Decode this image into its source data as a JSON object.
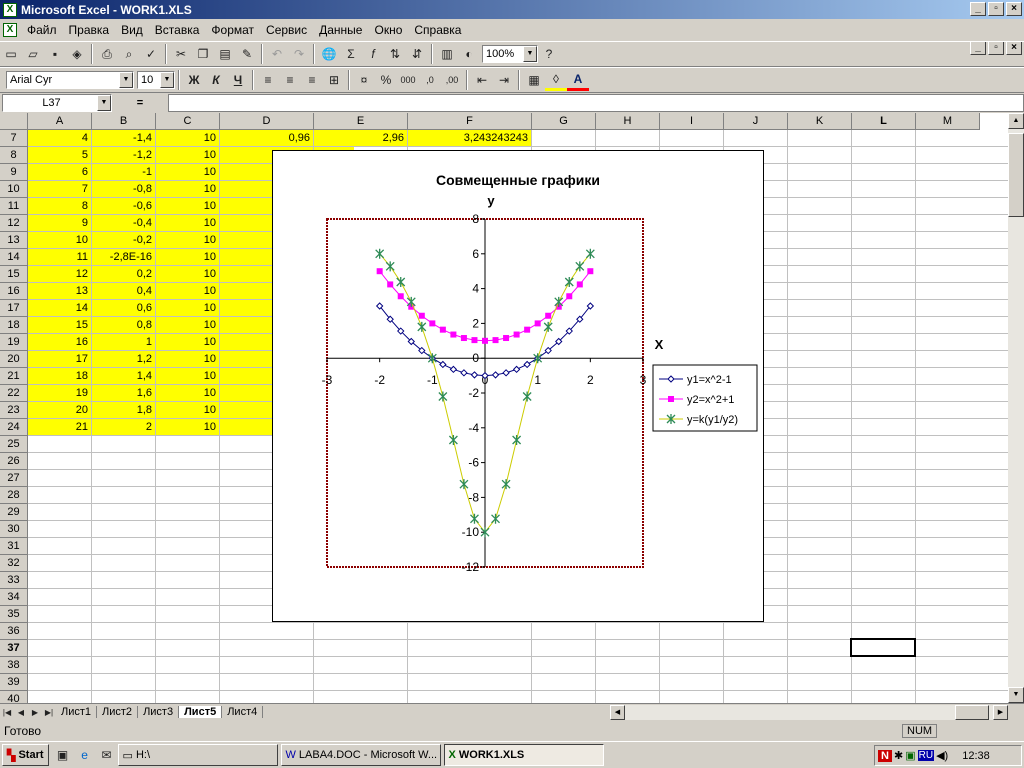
{
  "window": {
    "title": "Microsoft Excel - WORK1.XLS",
    "minimize": "_",
    "restore": "▫",
    "close": "×"
  },
  "menu": [
    "Файл",
    "Правка",
    "Вид",
    "Вставка",
    "Формат",
    "Сервис",
    "Данные",
    "Окно",
    "Справка"
  ],
  "toolbar": {
    "zoom": "100%"
  },
  "format_toolbar": {
    "font": "Arial Cyr",
    "size": "10",
    "bold": "Ж",
    "italic": "К",
    "underline": "Ч"
  },
  "formula_bar": {
    "name_box": "L37",
    "equals": "="
  },
  "columns": [
    "A",
    "B",
    "C",
    "D",
    "E",
    "F",
    "G",
    "H",
    "I",
    "J",
    "K",
    "L",
    "M"
  ],
  "row_numbers": [
    "7",
    "8",
    "9",
    "10",
    "11",
    "12",
    "13",
    "14",
    "15",
    "16",
    "17",
    "18",
    "19",
    "20",
    "21",
    "22",
    "23",
    "24",
    "25",
    "26",
    "27",
    "28",
    "29",
    "30",
    "31",
    "32",
    "33",
    "34",
    "35",
    "36",
    "37",
    "38",
    "39",
    "40"
  ],
  "cells": {
    "A": [
      "4",
      "5",
      "6",
      "7",
      "8",
      "9",
      "10",
      "11",
      "12",
      "13",
      "14",
      "15",
      "16",
      "17",
      "18",
      "19",
      "20",
      "21"
    ],
    "B": [
      "-1,4",
      "-1,2",
      "-1",
      "-0,8",
      "-0,6",
      "-0,4",
      "-0,2",
      "-2,8E-16",
      "0,2",
      "0,4",
      "0,6",
      "0,8",
      "1",
      "1,2",
      "1,4",
      "1,6",
      "1,8",
      "2"
    ],
    "C": [
      "10",
      "10",
      "10",
      "10",
      "10",
      "10",
      "10",
      "10",
      "10",
      "10",
      "10",
      "10",
      "10",
      "10",
      "10",
      "10",
      "10",
      "10"
    ],
    "D7": "0,96",
    "E7": "2,96",
    "F7": "3,243243243"
  },
  "highlight_color": "#ffff00",
  "sheet_tabs": [
    "Лист1",
    "Лист2",
    "Лист3",
    "Лист5",
    "Лист4"
  ],
  "active_sheet": "Лист5",
  "status": {
    "ready": "Готово",
    "num": "NUM"
  },
  "taskbar": {
    "start": "Start",
    "items": [
      "H:\\",
      "LABA4.DOC - Microsoft W...",
      "WORK1.XLS"
    ],
    "lang": "RU",
    "clock": "12:38"
  },
  "chart_data": {
    "type": "line",
    "title": "Совмещенные графики",
    "xlabel": "X",
    "ylabel": "y",
    "xlim": [
      -3,
      3
    ],
    "ylim": [
      -12,
      8
    ],
    "x_ticks": [
      "-3",
      "-2",
      "-1",
      "0",
      "1",
      "2",
      "3"
    ],
    "y_ticks": [
      "8",
      "6",
      "4",
      "2",
      "0",
      "-2",
      "-4",
      "-6",
      "-8",
      "-10",
      "-12"
    ],
    "x": [
      -2,
      -1.8,
      -1.6,
      -1.4,
      -1.2,
      -1,
      -0.8,
      -0.6,
      -0.4,
      -0.2,
      0,
      0.2,
      0.4,
      0.6,
      0.8,
      1,
      1.2,
      1.4,
      1.6,
      1.8,
      2
    ],
    "series": [
      {
        "name": "y1=x^2-1",
        "color": "#000080",
        "marker": "diamond",
        "values": [
          3,
          2.24,
          1.56,
          0.96,
          0.44,
          0,
          -0.36,
          -0.64,
          -0.84,
          -0.96,
          -1,
          -0.96,
          -0.84,
          -0.64,
          -0.36,
          0,
          0.44,
          0.96,
          1.56,
          2.24,
          3
        ]
      },
      {
        "name": "y2=x^2+1",
        "color": "#ff00ff",
        "marker": "square",
        "values": [
          5,
          4.24,
          3.56,
          2.96,
          2.44,
          2,
          1.64,
          1.36,
          1.16,
          1.04,
          1,
          1.04,
          1.16,
          1.36,
          1.64,
          2,
          2.44,
          2.96,
          3.56,
          4.24,
          5
        ]
      },
      {
        "name": "y=k(y1/y2)",
        "color": "#cccc00",
        "marker": "star",
        "values": [
          6,
          5.28,
          4.38,
          3.24,
          1.8,
          0,
          -2.2,
          -4.7,
          -7.24,
          -9.23,
          -10,
          -9.23,
          -7.24,
          -4.7,
          -2.2,
          0,
          1.8,
          3.24,
          4.38,
          5.28,
          6
        ]
      }
    ]
  }
}
